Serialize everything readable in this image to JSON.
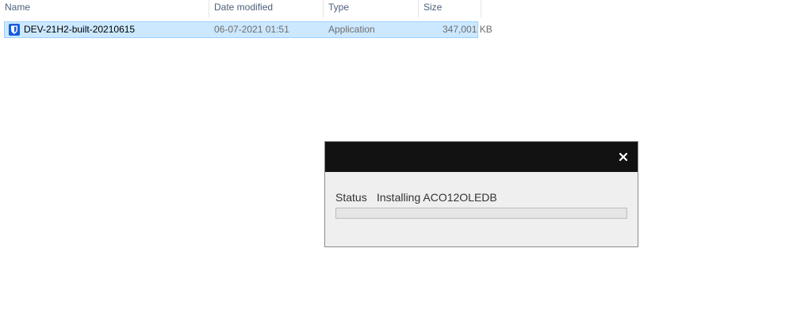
{
  "explorer": {
    "columns": {
      "name": "Name",
      "date_modified": "Date modified",
      "type": "Type",
      "size": "Size"
    },
    "rows": [
      {
        "icon": "bitwarden-shield-icon",
        "name": "DEV-21H2-built-20210615",
        "date_modified": "06-07-2021 01:51",
        "type": "Application",
        "size": "347,001 KB",
        "selected": true
      }
    ]
  },
  "dialog": {
    "close_glyph": "×",
    "status_label": "Status",
    "status_value": "Installing ACO12OLEDB",
    "progress": 0
  }
}
